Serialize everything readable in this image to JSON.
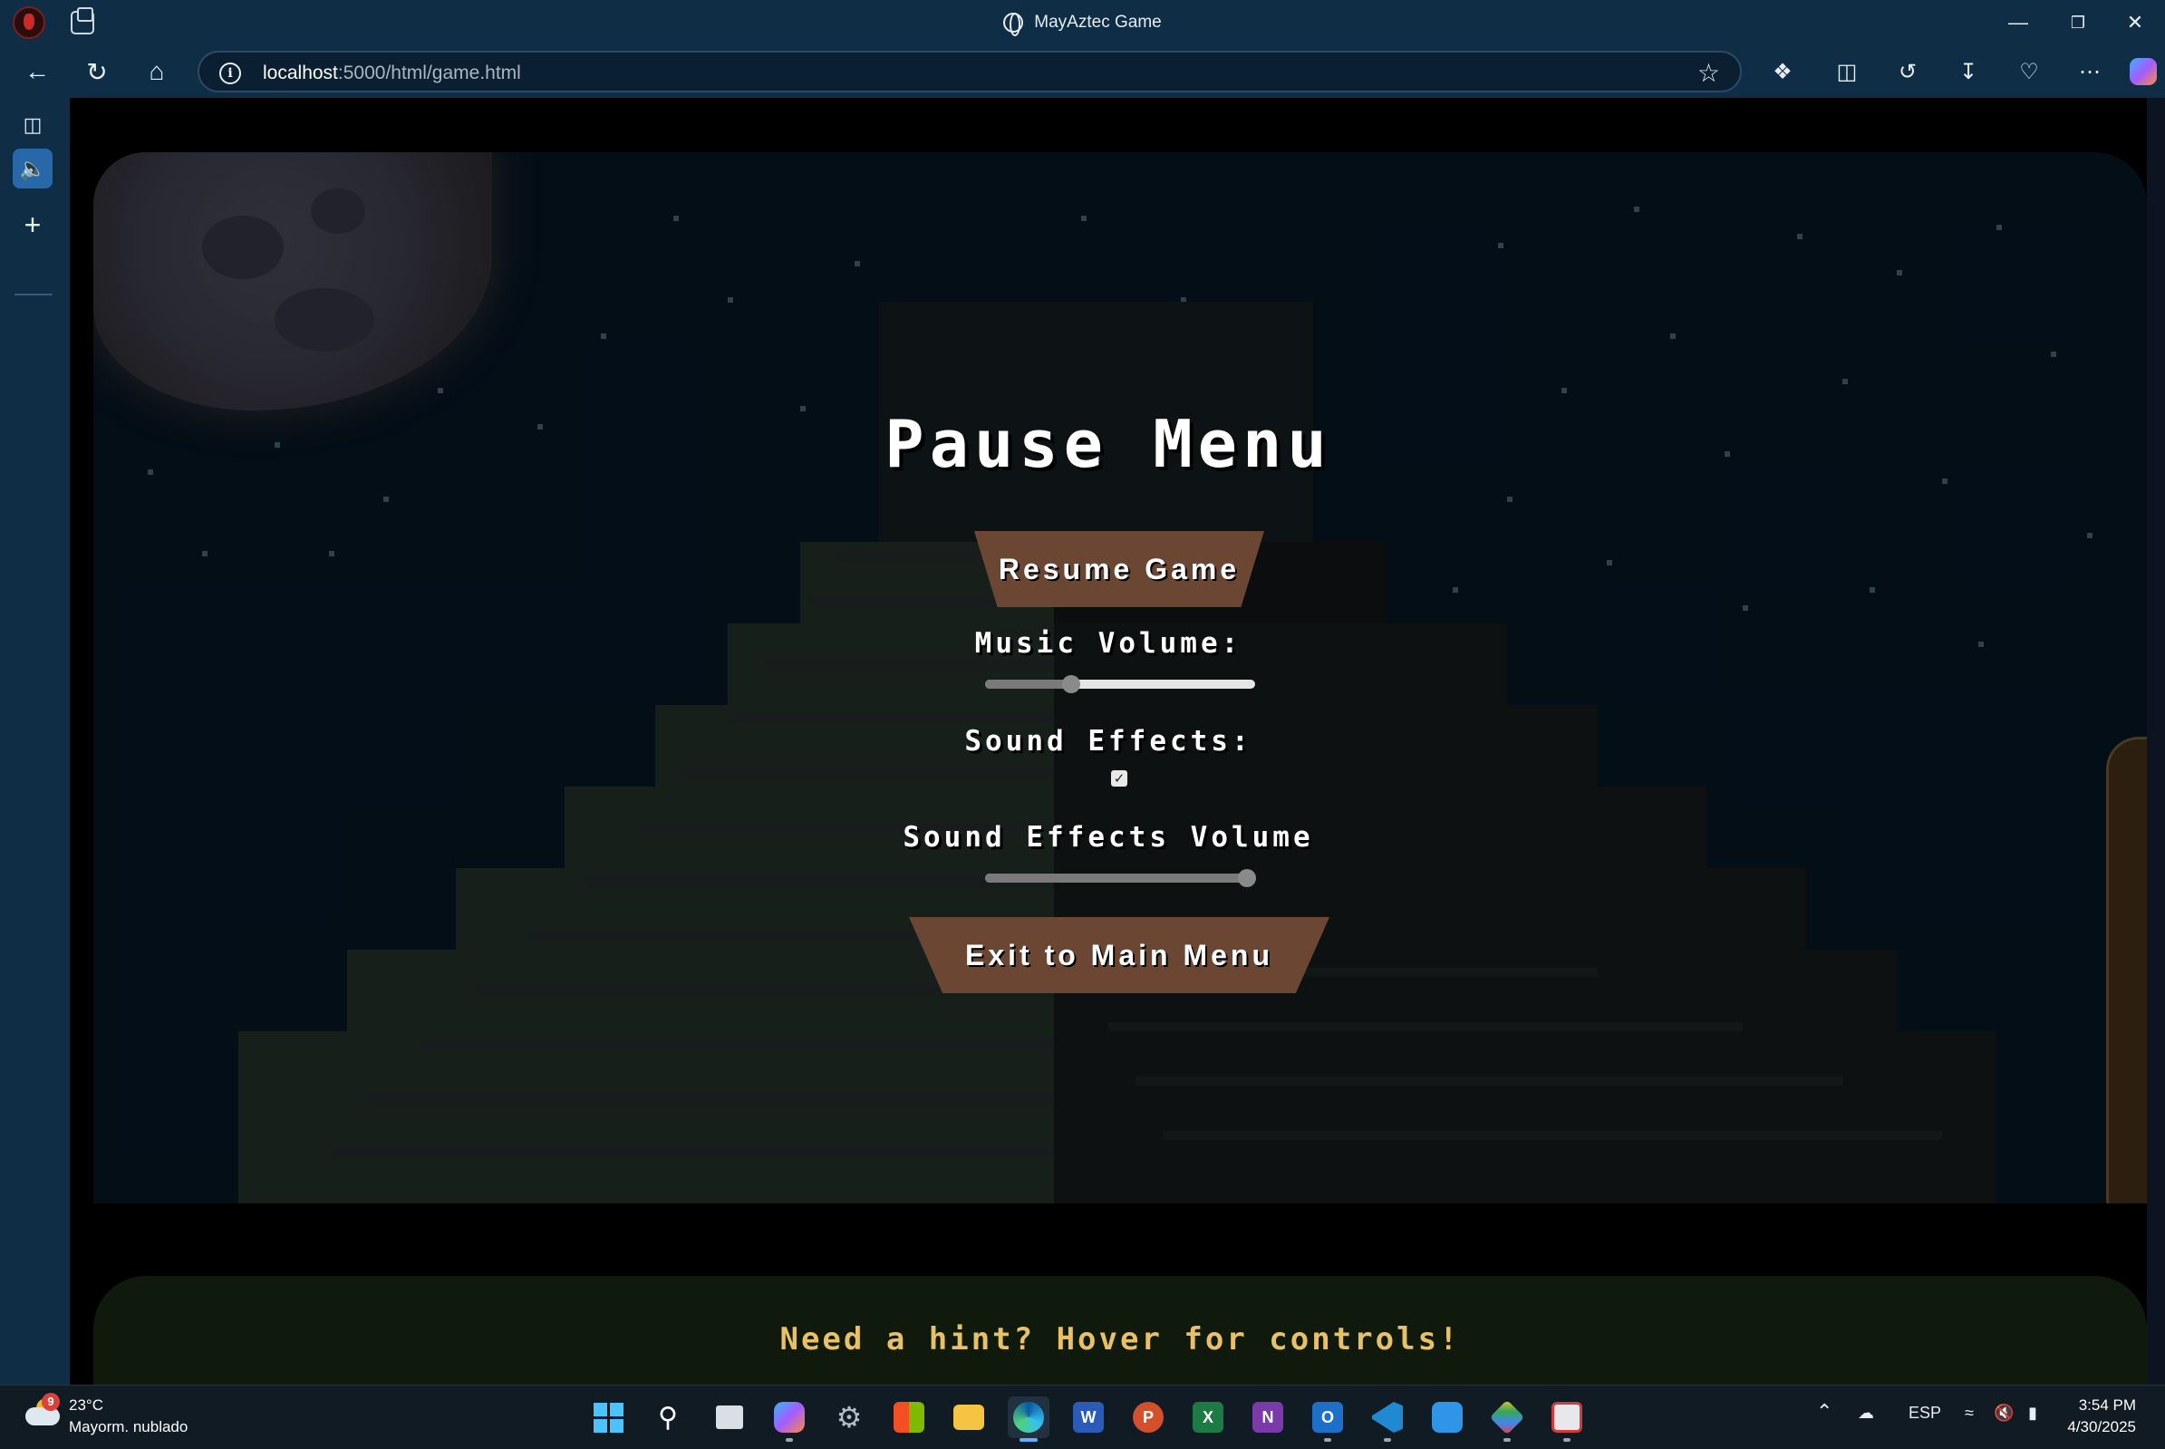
{
  "window": {
    "title": "MayAztec Game",
    "minimize": "—",
    "restore": "❐",
    "close": "✕"
  },
  "address_bar": {
    "url_host": "localhost",
    "url_rest": ":5000/html/game.html"
  },
  "game": {
    "pause_title": "Pause Menu",
    "resume_label": "Resume Game",
    "music_label": "Music Volume:",
    "music_volume": 0.32,
    "sfx_label": "Sound Effects:",
    "sfx_enabled": true,
    "sfx_volume_label": "Sound Effects Volume",
    "sfx_volume": 0.97,
    "exit_label": "Exit to Main Menu",
    "hint": "Need a hint? Hover for controls!"
  },
  "taskbar": {
    "weather_badge": "9",
    "temperature": "23°C",
    "weather_desc": "Mayorm. nublado",
    "language": "ESP",
    "time": "3:54 PM",
    "date": "4/30/2025"
  },
  "colors": {
    "chrome_bg": "#0f2d45",
    "button_brown": "#6b4632",
    "hint_gold": "#e8c066",
    "sky": "#081a2b"
  }
}
